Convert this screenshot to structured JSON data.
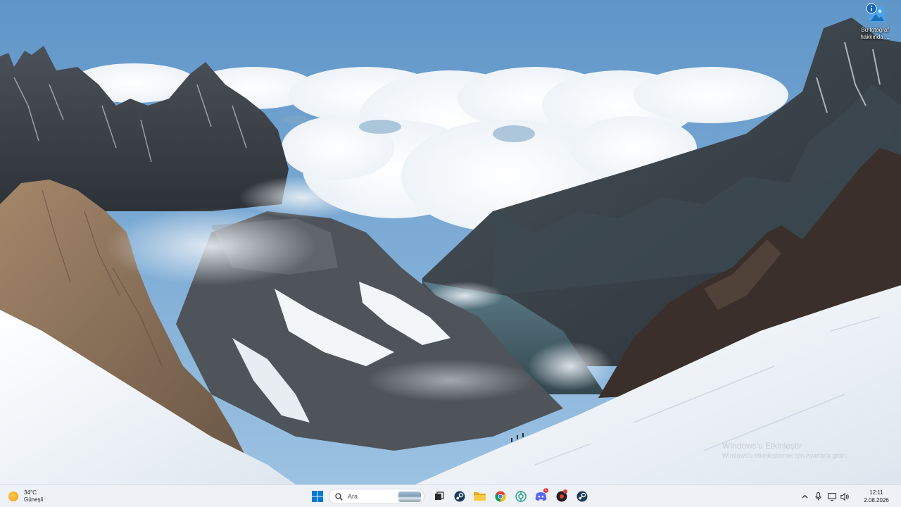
{
  "desktop": {
    "icons": [
      {
        "label": "Bu fotoğraf hakkında ...",
        "icon": "info-photo-icon"
      }
    ]
  },
  "watermark": {
    "title": "Windows'u Etkinleştir",
    "subtitle": "Windows'u etkinleştirmek için Ayarlar'a gidin."
  },
  "taskbar": {
    "weather": {
      "temperature": "34°C",
      "condition": "Güneşli",
      "icon": "sun-icon"
    },
    "start_icon": "windows-start-icon",
    "search": {
      "placeholder": "Ara"
    },
    "apps": [
      {
        "name": "task-view",
        "icon": "task-view-icon"
      },
      {
        "name": "steam",
        "icon": "steam-icon"
      },
      {
        "name": "file-explorer",
        "icon": "folder-icon"
      },
      {
        "name": "chrome",
        "icon": "chrome-icon"
      },
      {
        "name": "chatgpt",
        "icon": "chatgpt-icon"
      },
      {
        "name": "discord",
        "icon": "discord-icon",
        "badge": "1"
      },
      {
        "name": "record-app",
        "icon": "record-icon"
      },
      {
        "name": "steam-2",
        "icon": "steam-icon"
      }
    ],
    "tray": {
      "icons": [
        "chevron-up-icon",
        "microphone-icon",
        "display-icon",
        "speaker-icon"
      ],
      "time": "12:11",
      "date": "2.08.2026"
    }
  },
  "colors": {
    "taskbar_bg": "#eef1f6",
    "accent": "#0078d4",
    "sky": "#6fa0cf"
  }
}
